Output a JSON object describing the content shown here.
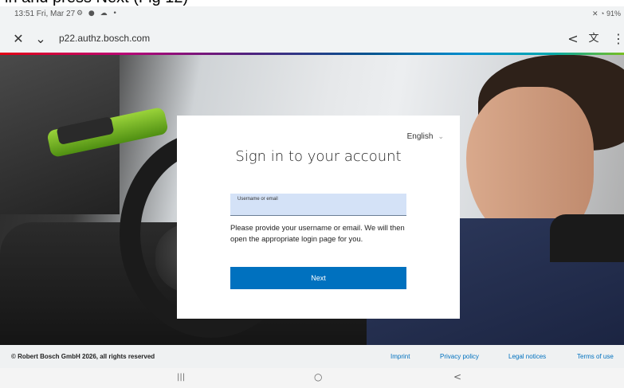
{
  "caption": {
    "text": "in and press Next (Fig 12)"
  },
  "status_bar": {
    "time": "13:51 Fri, Mar 27",
    "icons_left": "⚙ ● ☁ •",
    "right": "✕ ◔ 91%"
  },
  "browser": {
    "close_icon": "✕",
    "dropdown_icon": "⌄",
    "url": "p22.authz.bosch.com",
    "share_icon": "<",
    "translate_icon": "文",
    "menu_icon": "⋮"
  },
  "login": {
    "language": "English",
    "language_chevron": "⌄",
    "title": "Sign in to your account",
    "field_label": "Username or email",
    "help_text": "Please provide your username or email. We will then open the appropriate login page for you.",
    "next_button": "Next"
  },
  "footer": {
    "copyright": "© Robert Bosch GmbH 2026, all rights reserved",
    "links": [
      "Imprint",
      "Privacy policy",
      "Legal notices",
      "Terms of use"
    ]
  },
  "nav_bar": {
    "recents": "|||",
    "home": "○",
    "back": "<"
  },
  "colors": {
    "accent": "#0071bf",
    "field_bg": "#d4e2f7",
    "footer_bg": "#eff1f2"
  }
}
